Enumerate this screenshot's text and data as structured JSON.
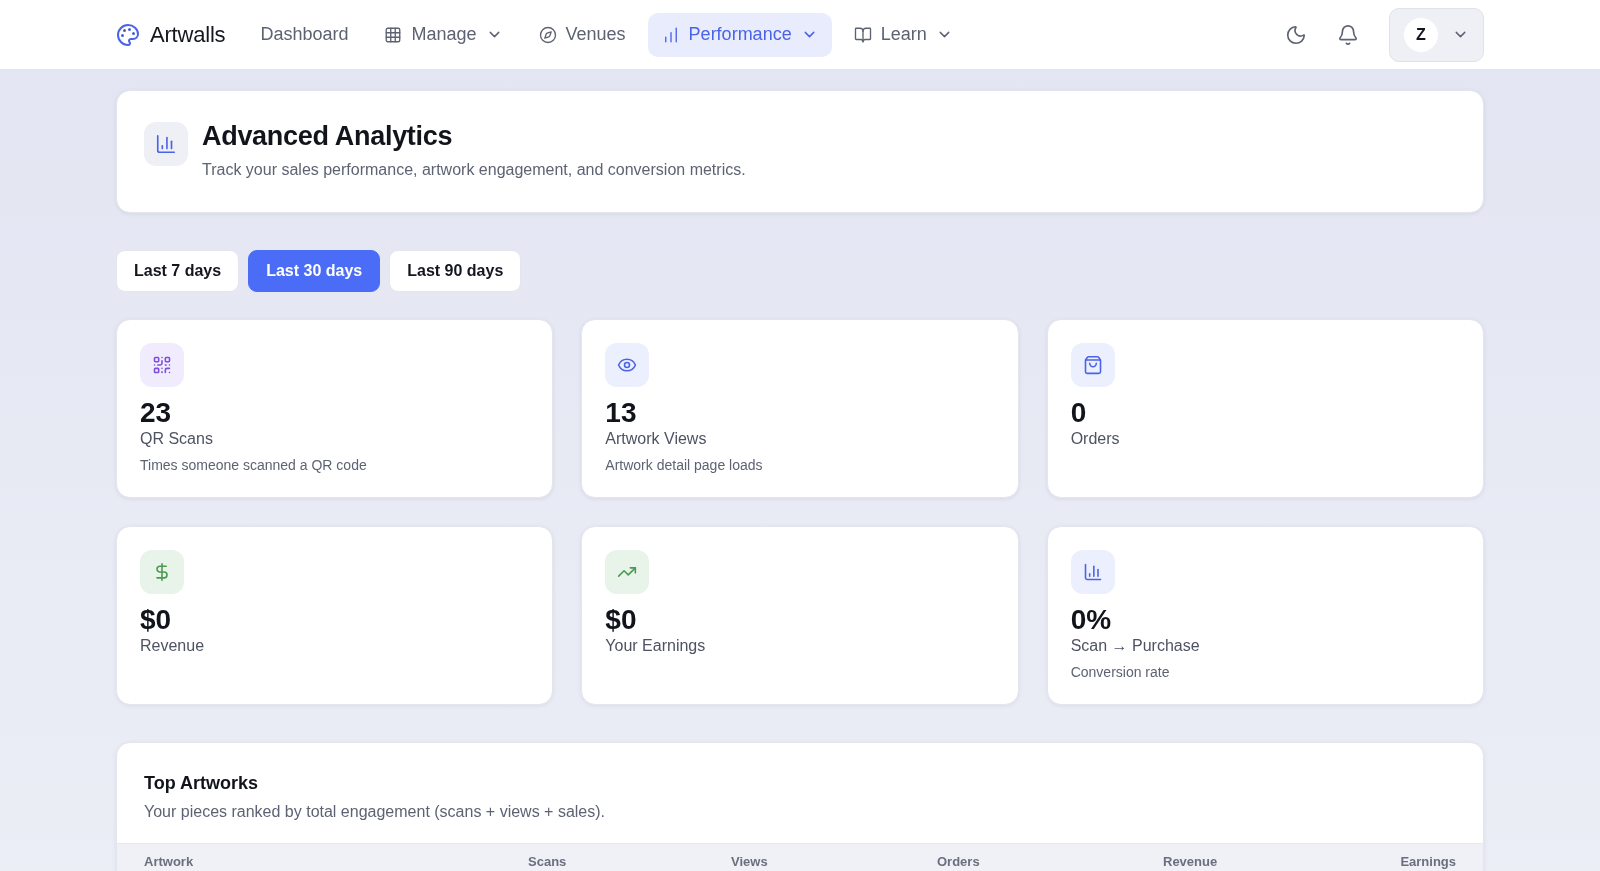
{
  "nav": {
    "brand": "Artwalls",
    "items": [
      {
        "label": "Dashboard",
        "kind": "link",
        "selected": false
      },
      {
        "label": "Manage",
        "kind": "menu",
        "selected": false
      },
      {
        "label": "Venues",
        "kind": "link",
        "selected": false
      },
      {
        "label": "Performance",
        "kind": "menu",
        "selected": true
      },
      {
        "label": "Learn",
        "kind": "menu",
        "selected": false
      }
    ],
    "user": {
      "initial": "Z"
    }
  },
  "header": {
    "title": "Advanced Analytics",
    "subtitle": "Track your sales performance, artwork engagement, and conversion metrics."
  },
  "ranges": [
    {
      "label": "Last 7 days",
      "selected": false
    },
    {
      "label": "Last 30 days",
      "selected": true
    },
    {
      "label": "Last 90 days",
      "selected": false
    }
  ],
  "stats": [
    {
      "kind": "scans",
      "value": "23",
      "label": "QR Scans",
      "description": "Times someone scanned a QR code"
    },
    {
      "kind": "views",
      "value": "13",
      "label": "Artwork Views",
      "description": "Artwork detail page loads"
    },
    {
      "kind": "orders",
      "value": "0",
      "label": "Orders"
    },
    {
      "kind": "revenue",
      "value": "$0",
      "label": "Revenue"
    },
    {
      "kind": "earnings",
      "value": "$0",
      "label": "Your Earnings"
    },
    {
      "kind": "conversion",
      "value": "0%",
      "label": "Scan → Purchase",
      "description": "Conversion rate"
    }
  ],
  "top_artworks": {
    "title": "Top Artworks",
    "subtitle": "Your pieces ranked by total engagement (scans + views + sales).",
    "columns": [
      "Artwork",
      "Scans",
      "Views",
      "Orders",
      "Revenue",
      "Earnings"
    ]
  }
}
